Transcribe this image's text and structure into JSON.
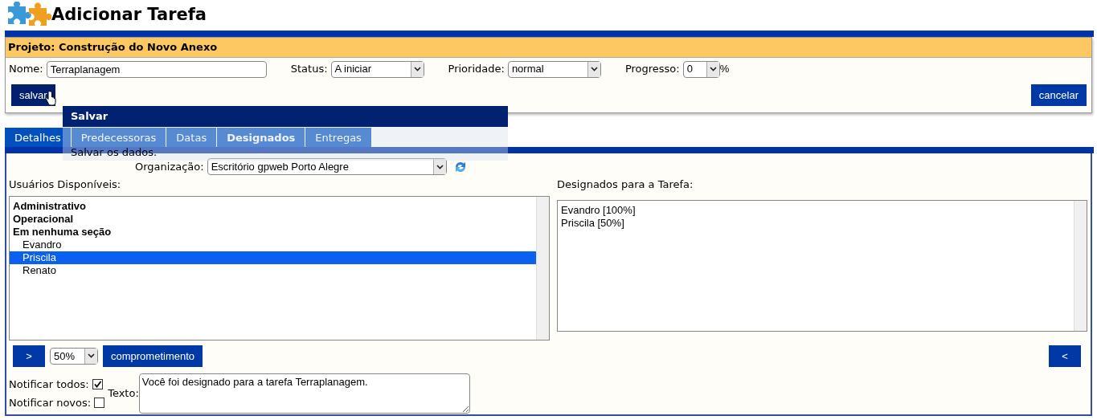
{
  "page_title": "Adicionar Tarefa",
  "project": "Projeto: Construção do Novo Anexo",
  "fields": [
    {
      "kind": "text",
      "label": "Nome:",
      "value": "Terraplanagem"
    },
    {
      "kind": "select",
      "label": "Status:",
      "value": "A iniciar"
    },
    {
      "kind": "select",
      "label": "Prioridade:",
      "value": "normal"
    },
    {
      "kind": "select",
      "label": "Progresso:",
      "value": "0",
      "suffix": "%"
    }
  ],
  "save_button": "salvar",
  "cancel_button": "cancelar",
  "tooltip": {
    "title": "Salvar",
    "text": "Salvar os dados."
  },
  "tabs": [
    {
      "label": "Detalhes",
      "selected": false
    },
    {
      "label": "Predecessoras",
      "selected": false
    },
    {
      "label": "Datas",
      "selected": false
    },
    {
      "label": "Designados",
      "selected": true
    },
    {
      "label": "Entregas",
      "selected": false
    }
  ],
  "organization": {
    "label": "Organização:",
    "value": "Escritório gpweb Porto Alegre"
  },
  "available": {
    "label": "Usuários Disponíveis:",
    "items": [
      {
        "label": "Administrativo",
        "selected": false
      },
      {
        "label": "Operacional",
        "selected": false
      },
      {
        "label": "Em nenhuma seção",
        "selected": false,
        "children": [
          {
            "label": "Evandro",
            "selected": false
          },
          {
            "label": "Priscila",
            "selected": true
          },
          {
            "label": "Renato",
            "selected": false
          }
        ]
      }
    ]
  },
  "assigned": {
    "label": "Designados para a Tarefa:",
    "items": [
      "Evandro [100%]",
      "Priscila [50%]"
    ]
  },
  "add_button": ">",
  "percent": "50%",
  "commitment_button": "comprometimento",
  "remove_button": "<",
  "notify": [
    {
      "label": "Notificar todos:",
      "checked": true
    },
    {
      "label": "Notificar novos:",
      "checked": false
    }
  ],
  "message": {
    "label": "Texto:",
    "value": "Você foi designado para a tarefa Terraplanagem."
  }
}
